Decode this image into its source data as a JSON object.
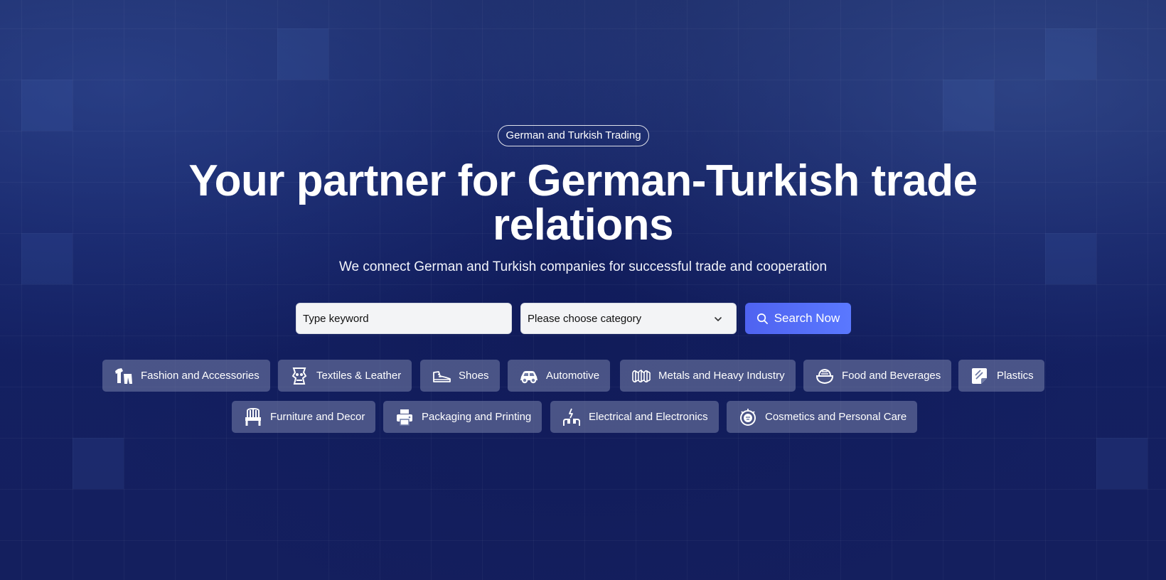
{
  "hero": {
    "badge": "German and Turkish Trading",
    "title_line1": "Your partner for German-Turkish trade",
    "title_line2": "relations",
    "subtitle": "We connect German and Turkish companies for successful trade and cooperation"
  },
  "search": {
    "keyword_placeholder": "Type keyword",
    "category_selected": "Please choose category",
    "button_label": "Search Now"
  },
  "categories": [
    {
      "label": "Fashion and Accessories",
      "icon": "clothing-icon"
    },
    {
      "label": "Textiles & Leather",
      "icon": "textile-icon"
    },
    {
      "label": "Shoes",
      "icon": "sneaker-icon"
    },
    {
      "label": "Automotive",
      "icon": "car-icon"
    },
    {
      "label": "Metals and Heavy Industry",
      "icon": "metal-coil-icon"
    },
    {
      "label": "Food and Beverages",
      "icon": "bowl-icon"
    },
    {
      "label": "Plastics",
      "icon": "plastic-sheet-icon"
    },
    {
      "label": "Furniture and Decor",
      "icon": "chair-icon"
    },
    {
      "label": "Packaging and Printing",
      "icon": "printer-icon"
    },
    {
      "label": "Electrical and Electronics",
      "icon": "electric-plug-icon"
    },
    {
      "label": "Cosmetics and Personal Care",
      "icon": "cosmetics-icon"
    }
  ],
  "colors": {
    "background": "#132063",
    "button_accent": "#5468f5",
    "chip_background": "#6f7ba6"
  }
}
